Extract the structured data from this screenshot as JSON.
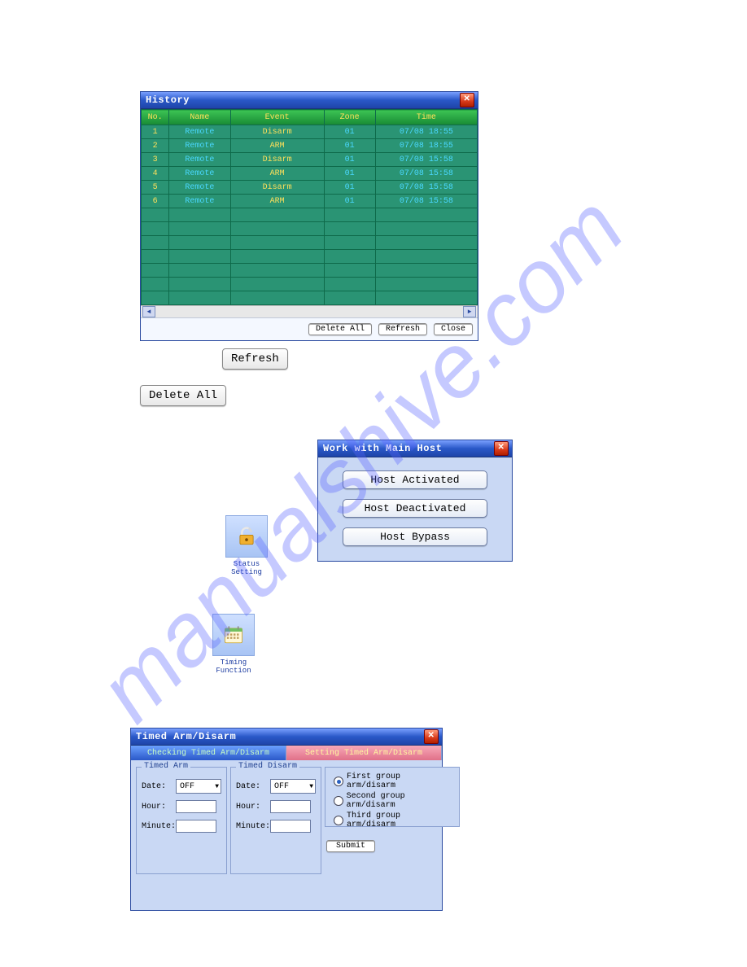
{
  "history": {
    "title": "History",
    "columns": {
      "no": "No.",
      "name": "Name",
      "event": "Event",
      "zone": "Zone",
      "time": "Time"
    },
    "rows": [
      {
        "no": "1",
        "name": "Remote",
        "event": "Disarm",
        "event_class": "ev-disarm",
        "zone": "01",
        "time": "07/08 18:55"
      },
      {
        "no": "2",
        "name": "Remote",
        "event": "ARM",
        "event_class": "ev-arm",
        "zone": "01",
        "time": "07/08 18:55"
      },
      {
        "no": "3",
        "name": "Remote",
        "event": "Disarm",
        "event_class": "ev-disarm",
        "zone": "01",
        "time": "07/08 15:58"
      },
      {
        "no": "4",
        "name": "Remote",
        "event": "ARM",
        "event_class": "ev-arm",
        "zone": "01",
        "time": "07/08 15:58"
      },
      {
        "no": "5",
        "name": "Remote",
        "event": "Disarm",
        "event_class": "ev-disarm",
        "zone": "01",
        "time": "07/08 15:58"
      },
      {
        "no": "6",
        "name": "Remote",
        "event": "ARM",
        "event_class": "ev-arm",
        "zone": "01",
        "time": "07/08 15:58"
      }
    ],
    "empty_rows": 7,
    "buttons": {
      "delete_all": "Delete All",
      "refresh": "Refresh",
      "close": "Close"
    }
  },
  "standalone": {
    "refresh": "Refresh",
    "delete_all": "Delete All"
  },
  "icons": {
    "status_label": "Status Setting",
    "timing_label": "Timing Function"
  },
  "host_win": {
    "title": "Work with Main Host",
    "activated": "Host Activated",
    "deactivated": "Host Deactivated",
    "bypass": "Host Bypass"
  },
  "timed_win": {
    "title": "Timed Arm/Disarm",
    "tab_check": "Checking Timed Arm/Disarm",
    "tab_setting": "Setting Timed Arm/Disarm",
    "group_arm": "Timed Arm",
    "group_disarm": "Timed Disarm",
    "labels": {
      "date": "Date:",
      "hour": "Hour:",
      "minute": "Minute:"
    },
    "date_off": "OFF",
    "radios": {
      "first": "First group arm/disarm",
      "second": "Second group arm/disarm",
      "third": "Third group arm/disarm"
    },
    "submit": "Submit"
  },
  "watermark_text": "manualshive.com"
}
